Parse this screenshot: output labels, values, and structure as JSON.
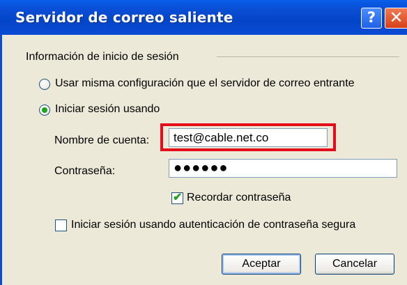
{
  "window": {
    "title": "Servidor de correo saliente",
    "help_glyph": "?",
    "close_glyph": "✕"
  },
  "login_group": {
    "legend": "Información de inicio de sesión",
    "radio_same_config": "Usar misma configuración que el servidor de correo entrante",
    "radio_login_using": "Iniciar sesión usando",
    "selected_option": "radio_login_using"
  },
  "fields": {
    "account_label": "Nombre de cuenta:",
    "account_value": "test@cable.net.co",
    "password_label": "Contraseña:",
    "password_value": "●●●●●●",
    "remember_password": "Recordar contraseña",
    "remember_checked": true,
    "secure_auth": "Iniciar sesión usando autenticación de contraseña segura",
    "secure_checked": false
  },
  "buttons": {
    "ok": "Aceptar",
    "cancel": "Cancelar"
  },
  "colors": {
    "highlight": "#e60d1a",
    "titlebar": "#0a4fd6",
    "radio_dot": "#21a121"
  }
}
